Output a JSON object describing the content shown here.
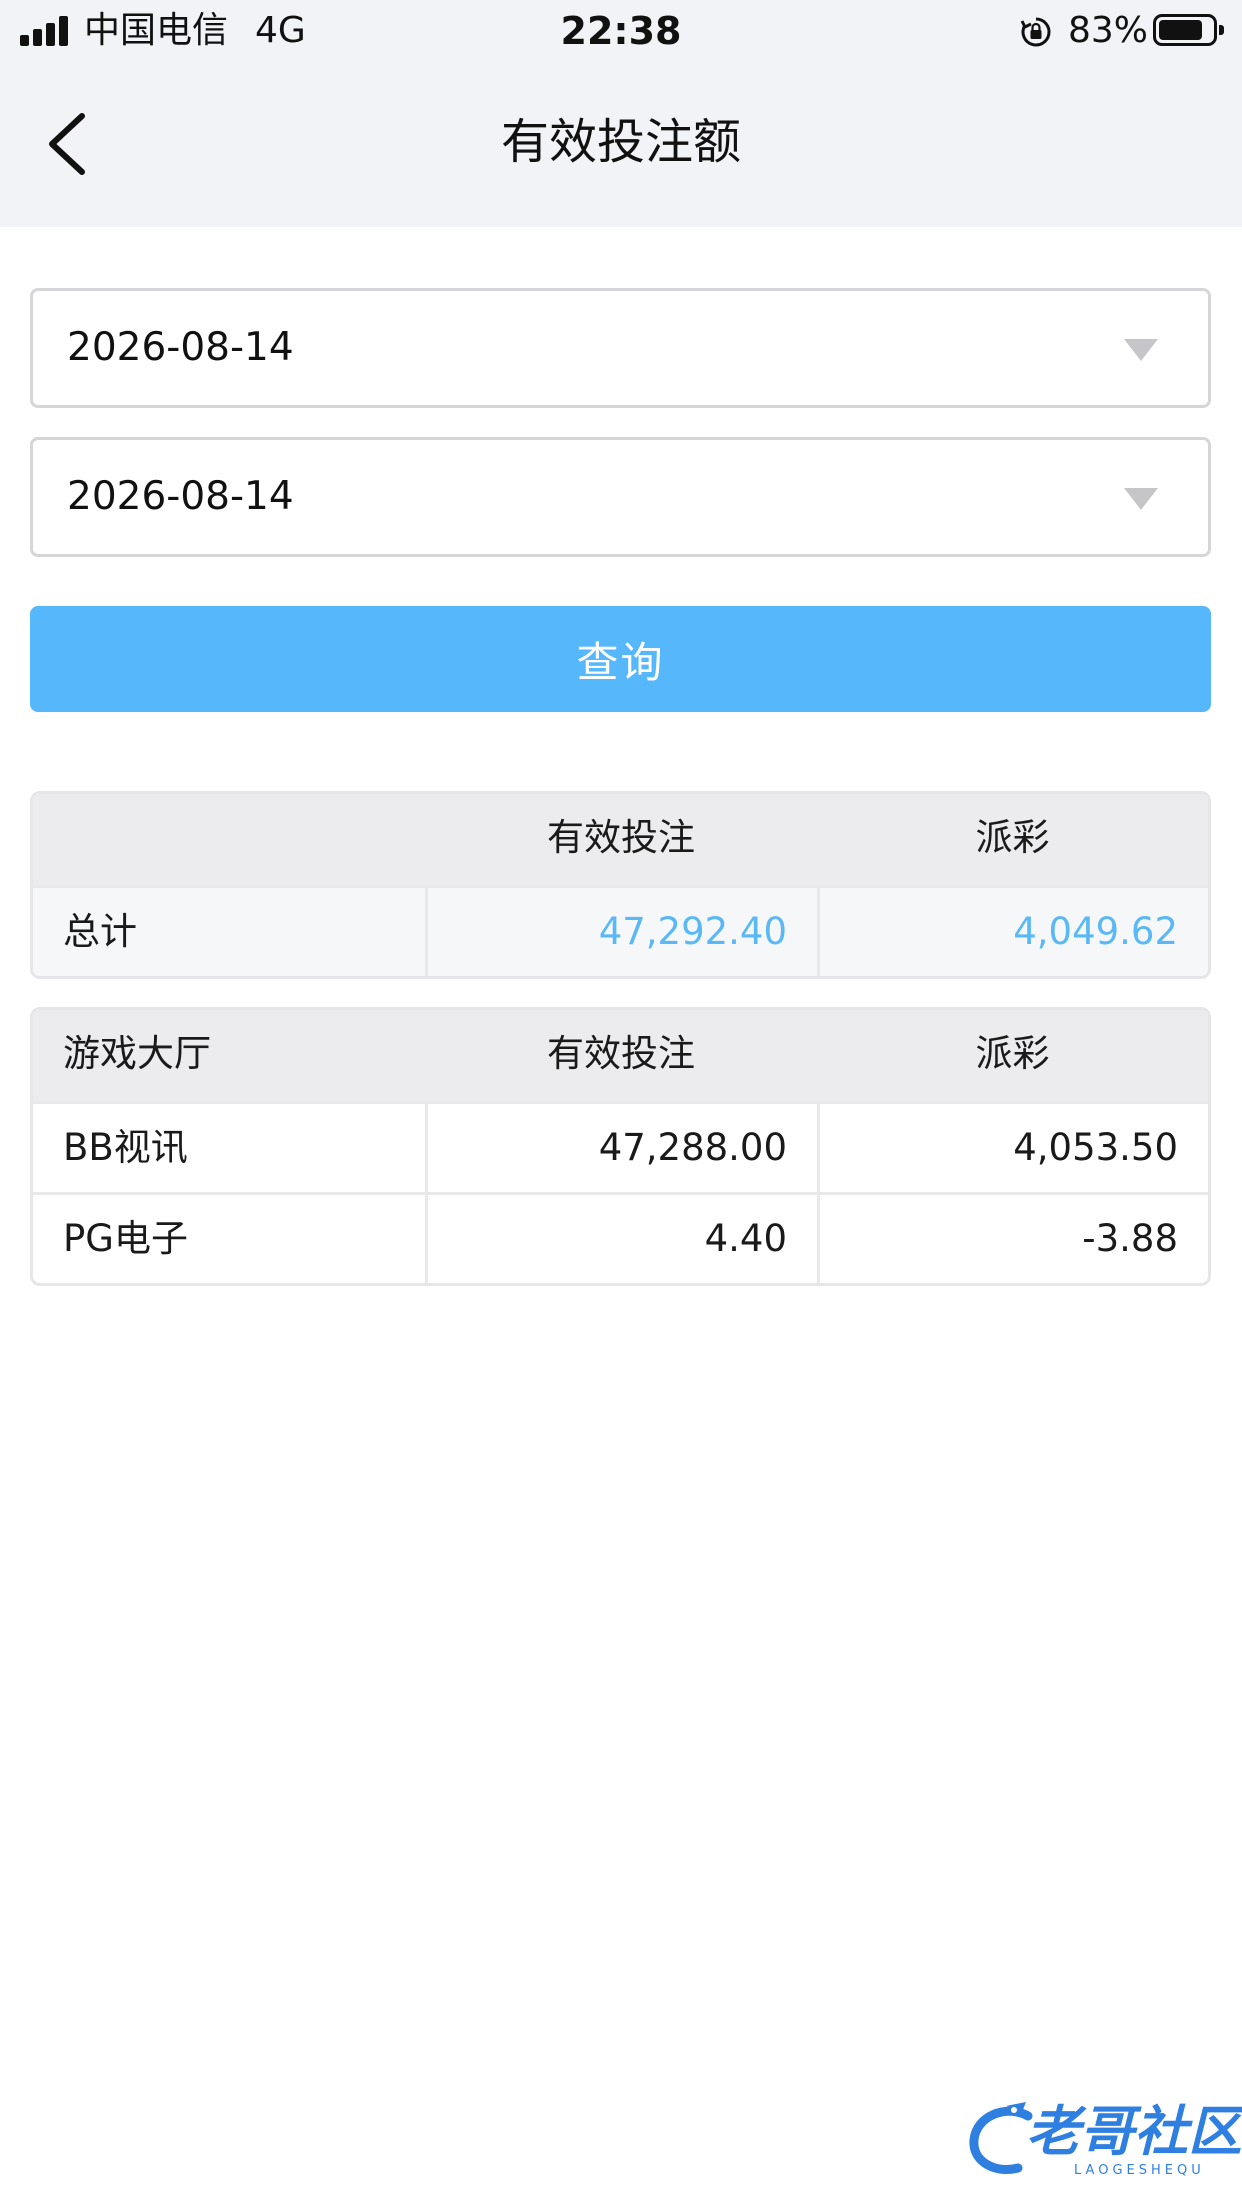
{
  "status_bar": {
    "carrier": "中国电信",
    "network": "4G",
    "time": "22:38",
    "battery_percent": "83%",
    "battery_level": 0.83,
    "icons": [
      "signal-icon",
      "rotation-lock-icon",
      "battery-icon"
    ]
  },
  "nav": {
    "back_icon": "chevron-left-icon",
    "title": "有效投注额"
  },
  "filters": {
    "start_date": "2026-08-14",
    "end_date": "2026-08-14",
    "caret_icon": "triangle-down-icon",
    "query_label": "查询"
  },
  "summary_table": {
    "columns": [
      "",
      "有效投注",
      "派彩"
    ],
    "row": {
      "label": "总计",
      "valid_bet": "47,292.40",
      "payout": "4,049.62"
    }
  },
  "detail_table": {
    "columns": [
      "游戏大厅",
      "有效投注",
      "派彩"
    ],
    "rows": [
      {
        "hall": "BB视讯",
        "valid_bet": "47,288.00",
        "payout": "4,053.50"
      },
      {
        "hall": "PG电子",
        "valid_bet": "4.40",
        "payout": "-3.88"
      }
    ]
  },
  "watermark": {
    "text": "老哥社区",
    "subtext": "LAOGESHEQU"
  },
  "colors": {
    "accent": "#56b7fb",
    "highlight_text": "#5ab8f5",
    "header_bg": "#f2f3f7",
    "table_head_bg": "#ececef"
  }
}
